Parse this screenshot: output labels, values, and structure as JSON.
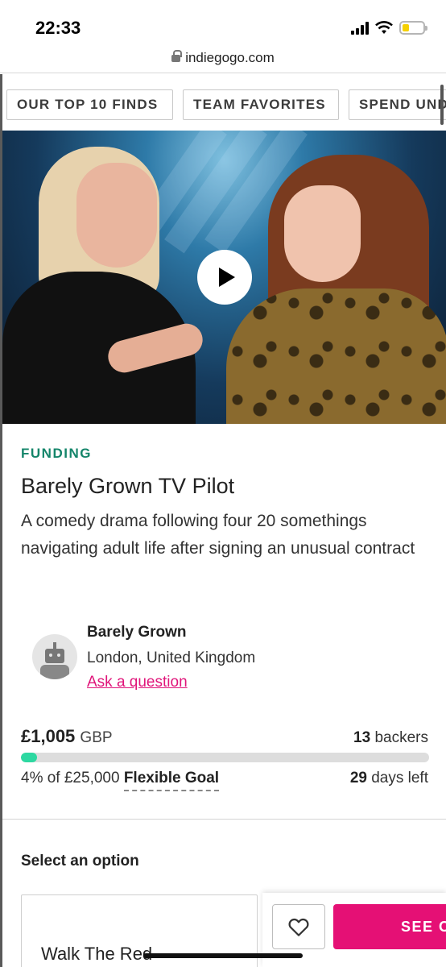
{
  "status_bar": {
    "time": "22:33",
    "battery_level": 0.35
  },
  "browser": {
    "url": "indiegogo.com"
  },
  "categories": [
    {
      "label": "OUR TOP 10 FINDS"
    },
    {
      "label": "TEAM FAVORITES"
    },
    {
      "label": "SPEND UND"
    }
  ],
  "campaign": {
    "status": "FUNDING",
    "title": "Barely Grown TV Pilot",
    "description": "A comedy drama following four 20 somethings navigating adult life after signing an unusual contract",
    "owner": {
      "name": "Barely Grown",
      "location": "London, United Kingdom",
      "ask_link": "Ask a question"
    },
    "funding": {
      "amount": "£1,005",
      "currency": "GBP",
      "backers_count": "13",
      "backers_label": "backers",
      "percent_text": "4% of £25,000",
      "goal_type": "Flexible Goal",
      "days_count": "29",
      "days_label": "days left",
      "progress_fraction": 0.04
    }
  },
  "options": {
    "heading": "Select an option",
    "perks": [
      {
        "title": "Walk The Red"
      }
    ]
  },
  "action_bar": {
    "see_label": "SEE O"
  },
  "colors": {
    "accent": "#e51075",
    "funding_green": "#14856a",
    "progress": "#2dd8a1"
  }
}
